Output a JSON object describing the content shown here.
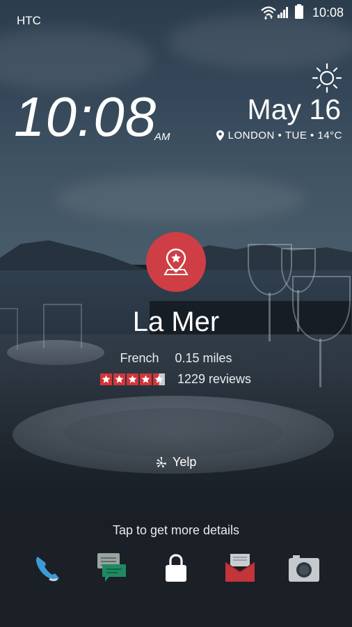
{
  "status_bar": {
    "carrier": "HTC",
    "time": "10:08",
    "icons": [
      "wifi-icon",
      "signal-icon",
      "battery-icon"
    ]
  },
  "lockscreen": {
    "clock": "10:08",
    "ampm": "AM",
    "date": "May 16",
    "location": "LONDON",
    "day": "TUE",
    "temperature": "14°C",
    "weather_icon": "sun-icon"
  },
  "card": {
    "category_icon": "location-star-pin-icon",
    "name": "La Mer",
    "cuisine": "French",
    "distance": "0.15 miles",
    "rating": 4.5,
    "rating_max": 5,
    "reviews": "1229 reviews",
    "source": "Yelp",
    "accent_color": "#cf3e45"
  },
  "hint": "Tap to get more details",
  "dock": {
    "items": [
      "phone-icon",
      "messages-icon",
      "lock-icon",
      "mail-icon",
      "camera-icon"
    ]
  }
}
